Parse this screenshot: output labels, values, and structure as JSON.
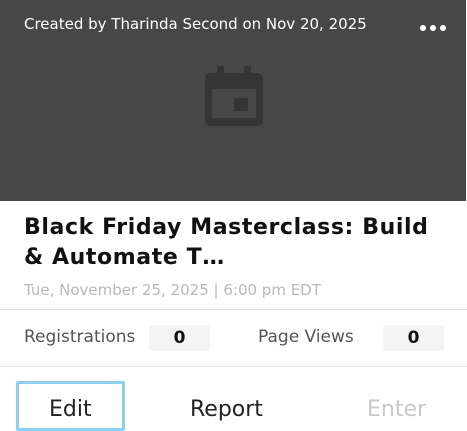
{
  "card": {
    "creator_text": "Created by Tharinda Second on Nov 20, 2025",
    "more_icon": "more-horizontal-icon",
    "thumbnail_icon": "calendar-icon",
    "title": "Black Friday Masterclass: Build & Automate T…",
    "date": "Tue, November 25, 2025 | 6:00 pm EDT",
    "stats": {
      "registrations_label": "Registrations",
      "registrations_value": "0",
      "page_views_label": "Page Views",
      "page_views_value": "0"
    },
    "actions": {
      "edit": "Edit",
      "report": "Report",
      "enter": "Enter"
    }
  },
  "colors": {
    "thumbnail_bg": "#474747",
    "focus_ring": "#8ed1ef",
    "disabled_text": "#c9c9c9"
  }
}
